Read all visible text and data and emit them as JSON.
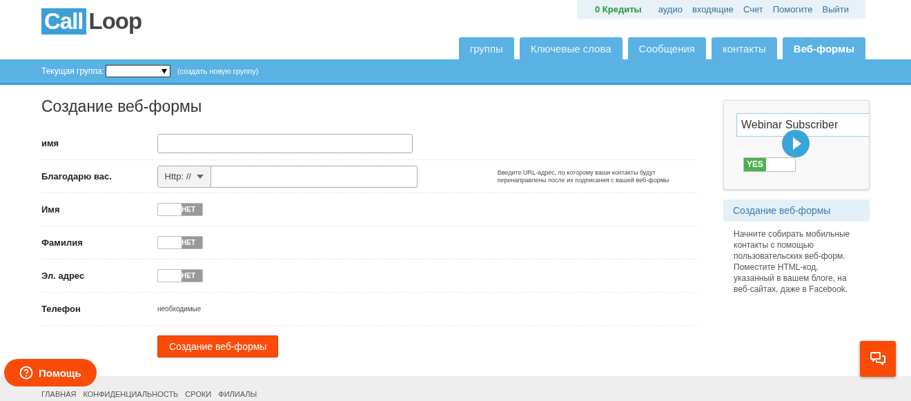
{
  "logo": {
    "left": "Call",
    "right": "Loop"
  },
  "top_links": {
    "credits": "0 Кредиты",
    "links": [
      "аудио",
      "входящие",
      "Счет",
      "Помогите",
      "Выйти"
    ]
  },
  "tabs": [
    {
      "label": "группы",
      "selected": false
    },
    {
      "label": "Ключевые слова",
      "selected": false
    },
    {
      "label": "Сообщения",
      "selected": false
    },
    {
      "label": "контакты",
      "selected": false
    },
    {
      "label": "Веб-формы",
      "selected": true
    }
  ],
  "group_bar": {
    "label": "Текущая группа:",
    "create_link": "(создать новую группу)"
  },
  "page_title": "Создание веб-формы",
  "form_rows": [
    {
      "kind": "text",
      "label": "имя"
    },
    {
      "kind": "url",
      "label": "Благодарю вас.",
      "prefix": "Http: //",
      "hint": "Введите URL-адрес, по которому ваши контакты будут перенаправлены после их подписания с вашей веб-формы"
    },
    {
      "kind": "toggle",
      "label": "Имя",
      "on": false,
      "state_text": "НЕТ"
    },
    {
      "kind": "toggle",
      "label": "Фамилия",
      "on": false,
      "state_text": "НЕТ"
    },
    {
      "kind": "toggle",
      "label": "Эл. адрес",
      "on": false,
      "state_text": "НЕТ"
    },
    {
      "kind": "static",
      "label": "Телефон",
      "value": "необходимые"
    }
  ],
  "submit_button": "Создание веб-формы",
  "sidebar": {
    "video": {
      "field_text": "Webinar Subscriber",
      "toggle_text": "YES",
      "on": true
    },
    "heading": "Создание веб-формы",
    "text": "Начните собирать мобильные контакты с помощью пользовательских веб-форм. Поместите HTML-код, указанный в вашем блоге, на веб-сайтах, даже в Facebook."
  },
  "help_button": "Помощь",
  "footer_links": [
    "ГЛАВНАЯ",
    "КОНФИДЕНЦИАЛЬНОСТЬ",
    "СРОКИ",
    "ФИЛИАЛЫ"
  ]
}
